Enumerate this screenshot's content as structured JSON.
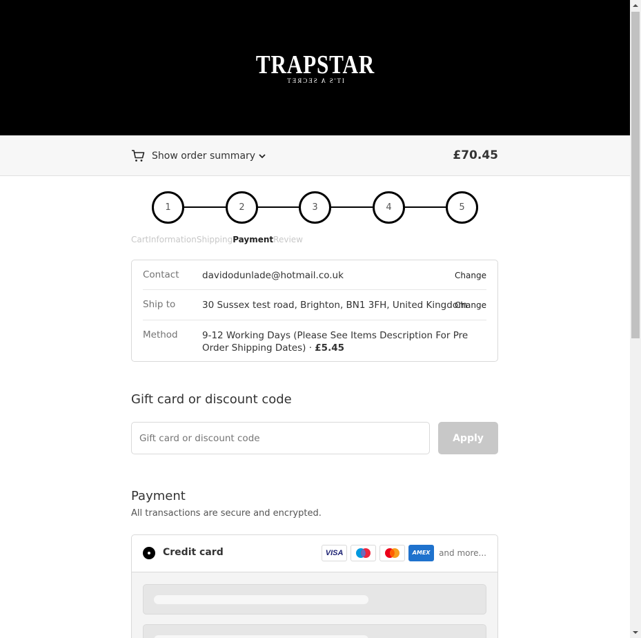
{
  "brand": {
    "name": "TRAPSTAR",
    "tagline": "IT'S A SECRET"
  },
  "summary": {
    "toggle_label": "Show order summary",
    "total": "£70.45"
  },
  "steps": {
    "numbers": [
      "1",
      "2",
      "3",
      "4",
      "5"
    ],
    "labels": [
      "Cart",
      "Information",
      "Shipping",
      "Payment",
      "Review"
    ],
    "active_label": "Payment"
  },
  "review": {
    "contact": {
      "label": "Contact",
      "value": "davidodunlade@hotmail.co.uk",
      "change": "Change"
    },
    "ship_to": {
      "label": "Ship to",
      "value": "30 Sussex test road, Brighton, BN1 3FH, United Kingdom",
      "change": "Change"
    },
    "method": {
      "label": "Method",
      "value": "9-12 Working Days (Please See Items Description For Pre Order Shipping Dates) · ",
      "price": "£5.45"
    }
  },
  "gift": {
    "title": "Gift card or discount code",
    "placeholder": "Gift card or discount code",
    "apply_label": "Apply"
  },
  "payment": {
    "title": "Payment",
    "subtitle": "All transactions are secure and encrypted.",
    "option_label": "Credit card",
    "cards": [
      "visa-icon",
      "maestro-icon",
      "mastercard-icon",
      "amex-icon"
    ],
    "visa_text": "VISA",
    "amex_text": "AMEX",
    "and_more": "and more..."
  },
  "colors": {
    "header_bg": "#000000",
    "summary_bg": "#f7f7f7",
    "apply_disabled": "#c8c8c8",
    "maestro_blue": "#0099df",
    "mastercard_orange": "#ff5f00"
  }
}
